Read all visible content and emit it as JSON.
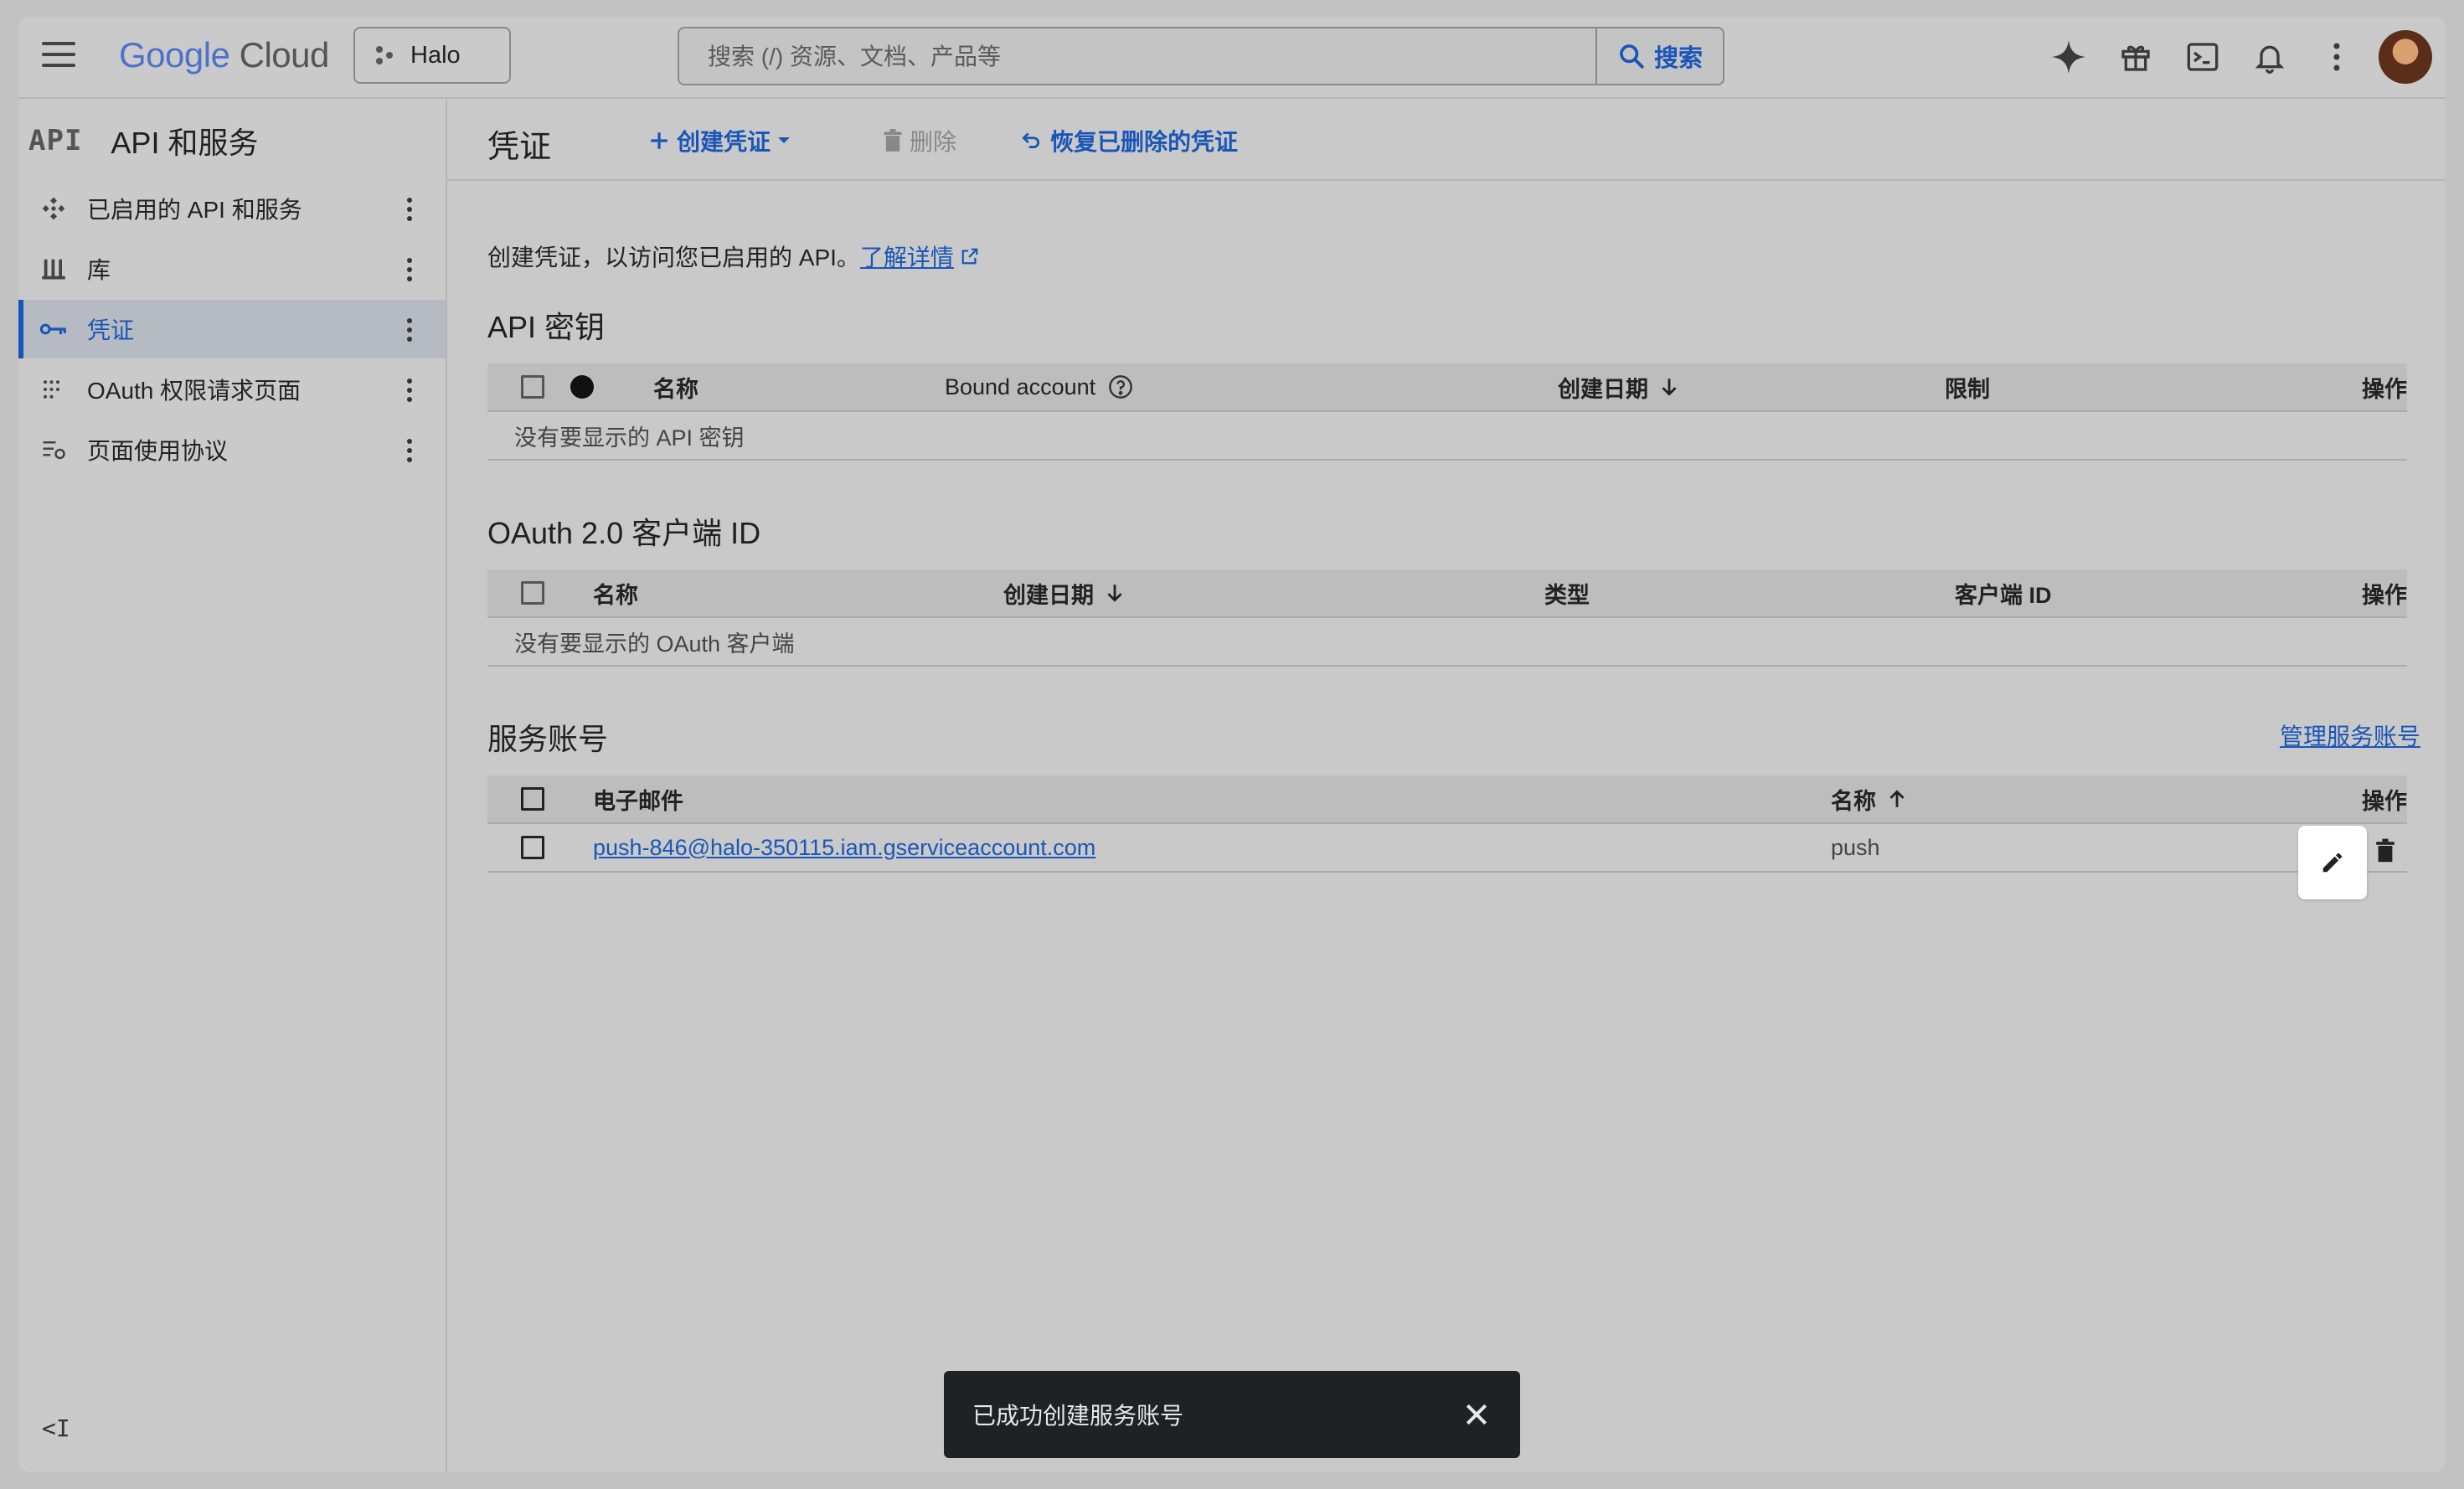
{
  "header": {
    "logo_google": "Google",
    "logo_cloud": "Cloud",
    "project": "Halo",
    "search_placeholder": "搜索 (/) 资源、文档、产品等",
    "search_button": "搜索",
    "icons": [
      "menu-icon",
      "gemini-sparkle-icon",
      "gift-icon",
      "cloud-shell-icon",
      "notifications-icon",
      "more-vert-icon",
      "avatar"
    ]
  },
  "sidebar": {
    "mark": "API",
    "title": "API 和服务",
    "items": [
      {
        "label": "已启用的 API 和服务",
        "icon": "enabled-apis-icon"
      },
      {
        "label": "库",
        "icon": "library-icon"
      },
      {
        "label": "凭证",
        "icon": "key-icon",
        "active": true
      },
      {
        "label": "OAuth 权限请求页面",
        "icon": "oauth-consent-icon"
      },
      {
        "label": "页面使用协议",
        "icon": "page-usage-icon"
      }
    ],
    "collapse": "<I"
  },
  "toolbar": {
    "title": "凭证",
    "create": "创建凭证",
    "delete": "删除",
    "restore": "恢复已删除的凭证"
  },
  "intro": {
    "text": "创建凭证，以访问您已启用的 API。",
    "link": "了解详情"
  },
  "api_keys": {
    "title": "API 密钥",
    "columns": [
      "名称",
      "Bound account",
      "创建日期",
      "限制",
      "操作"
    ],
    "empty": "没有要显示的 API 密钥"
  },
  "oauth": {
    "title": "OAuth 2.0 客户端 ID",
    "columns": [
      "名称",
      "创建日期",
      "类型",
      "客户端 ID",
      "操作"
    ],
    "empty": "没有要显示的 OAuth 客户端"
  },
  "service_accounts": {
    "title": "服务账号",
    "manage": "管理服务账号",
    "columns": [
      "电子邮件",
      "名称",
      "操作"
    ],
    "rows": [
      {
        "email": "push-846@halo-350115.iam.gserviceaccount.com",
        "name": "push"
      }
    ]
  },
  "snackbar": {
    "message": "已成功创建服务账号"
  },
  "colors": {
    "accent": "#1a56b8",
    "snackbar_bg": "#202124"
  }
}
